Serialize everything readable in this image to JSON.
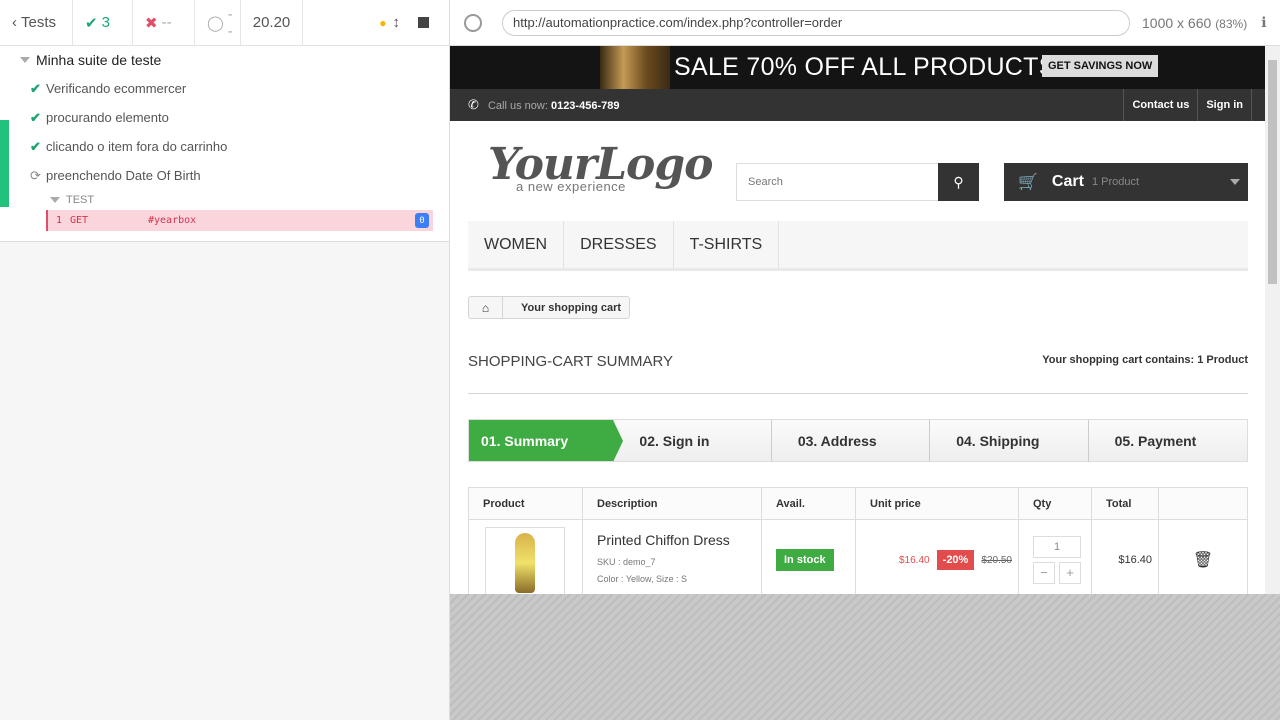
{
  "reporter": {
    "back_label": "Tests",
    "passed": "3",
    "failed": "--",
    "pending": "--",
    "duration": "20.20"
  },
  "suite": {
    "title": "Minha suite de teste",
    "tests": [
      {
        "label": "Verificando ecommercer",
        "state": "passed"
      },
      {
        "label": "procurando elemento",
        "state": "passed"
      },
      {
        "label": "clicando o item fora do carrinho",
        "state": "passed"
      },
      {
        "label": "preenchendo Date Of Birth",
        "state": "running"
      }
    ],
    "hook_label": "TEST",
    "command": {
      "number": "1",
      "name": "GET",
      "selector": "#yearbox",
      "badge": "0"
    }
  },
  "aut": {
    "url": "http://automationpractice.com/index.php?controller=order",
    "viewport": "1000 x 660",
    "scale": "(83%)"
  },
  "site": {
    "banner_text": "SALE 70% OFF ALL PRODUCTS",
    "banner_button": "GET SAVINGS NOW",
    "call_label": "Call us now:",
    "call_number": "0123-456-789",
    "contact": "Contact us",
    "signin": "Sign in",
    "logo_main": "YourLogo",
    "logo_sub": "a new experience",
    "search_placeholder": "Search",
    "cart_label": "Cart",
    "cart_products": "1 Product",
    "menu": [
      "WOMEN",
      "DRESSES",
      "T-SHIRTS"
    ],
    "breadcrumb": "Your shopping cart",
    "summary_title": "SHOPPING-CART SUMMARY",
    "cart_contains": "Your shopping cart contains: 1 Product",
    "steps": [
      "01. Summary",
      "02. Sign in",
      "03. Address",
      "04. Shipping",
      "05. Payment"
    ],
    "table_headers": [
      "Product",
      "Description",
      "Avail.",
      "Unit price",
      "Qty",
      "Total",
      ""
    ],
    "item": {
      "name": "Printed Chiffon Dress",
      "sku": "SKU : demo_7",
      "color": "Color : Yellow, Size : S",
      "avail": "In stock",
      "price": "$16.40",
      "discount": "-20%",
      "old_price": "$20.50",
      "qty": "1",
      "total": "$16.40"
    }
  },
  "colors": {
    "pass": "#1ea672",
    "fail": "#e04e6a",
    "green": "#3fab43",
    "dark": "#333333"
  }
}
